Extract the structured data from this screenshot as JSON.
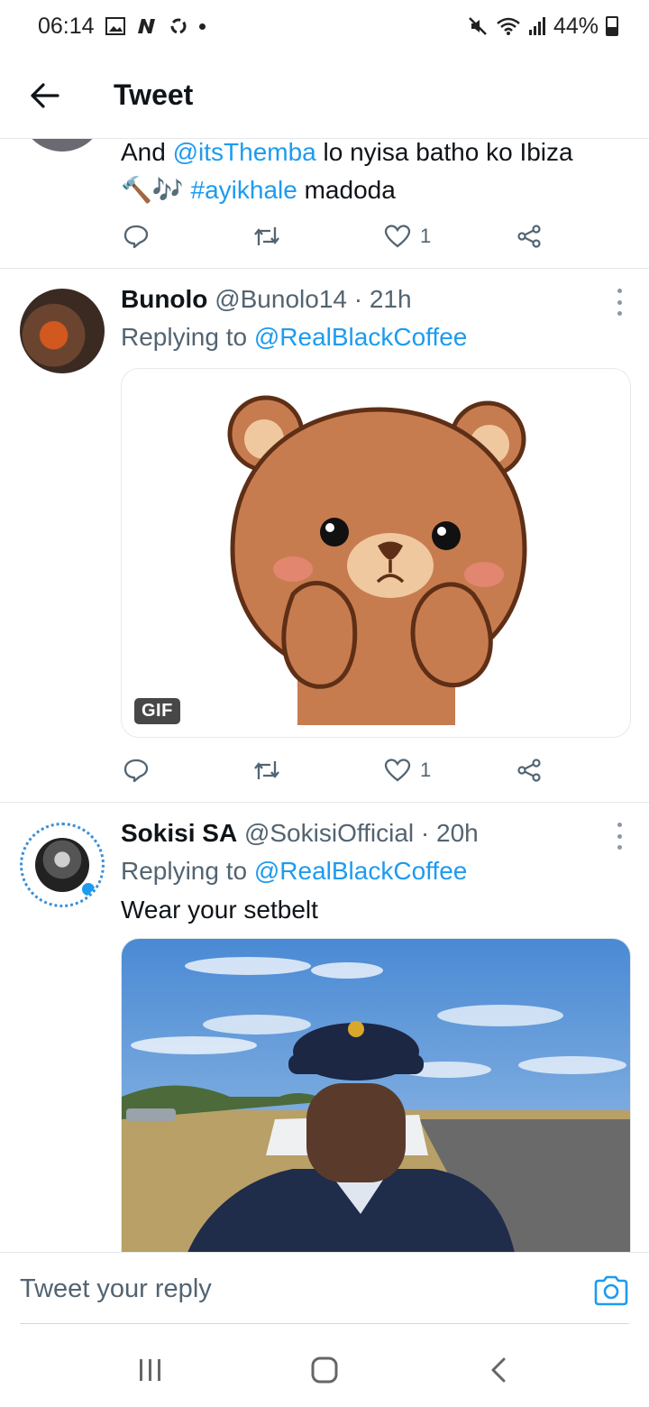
{
  "status_bar": {
    "time": "06:14",
    "battery": "44%",
    "icons": [
      "gallery-icon",
      "n-app-icon",
      "sync-icon",
      "mute-icon",
      "wifi-icon",
      "signal-icon",
      "battery-icon"
    ]
  },
  "header": {
    "title": "Tweet"
  },
  "tweets": [
    {
      "text_before": "And ",
      "mention": "@itsThemba",
      "text_middle": " lo nyisa batho ko Ibiza",
      "emoji": "🔨🎶",
      "hashtag": "#ayikhale",
      "text_after": " madoda",
      "likes": "1"
    },
    {
      "name": "Bunolo",
      "handle": "@Bunolo14",
      "time": "· 21h",
      "replying_label": "Replying to",
      "replying_to": "@RealBlackCoffee",
      "media_badge": "GIF",
      "likes": "1"
    },
    {
      "name": "Sokisi SA",
      "handle": "@SokisiOfficial",
      "time": "· 20h",
      "replying_label": "Replying to",
      "replying_to": "@RealBlackCoffee",
      "text": "Wear your setbelt"
    }
  ],
  "composer": {
    "placeholder": "Tweet your reply"
  },
  "colors": {
    "accent": "#1d9bf0",
    "secondary_text": "#536471",
    "divider": "#e6e9ea"
  }
}
